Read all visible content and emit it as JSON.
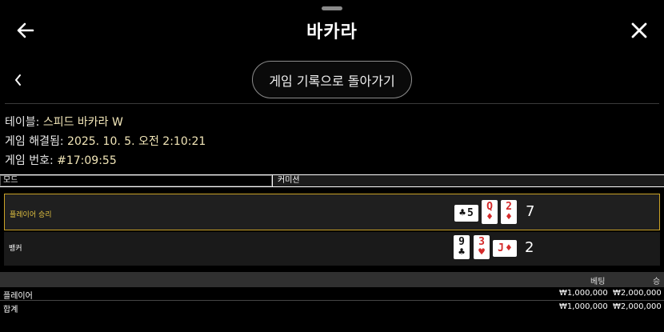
{
  "header": {
    "title": "바카라",
    "back_icon": "arrow-left-icon",
    "close_icon": "close-icon"
  },
  "nav": {
    "prev_icon": "chevron-left-icon",
    "back_to_history_label": "게임 기록으로 돌아가기"
  },
  "info": {
    "table_label": "테이블:",
    "table_value": "스피드 바카라 W",
    "resolved_label": "게임 해결됨:",
    "resolved_value": "2025. 10. 5. 오전 2:10:21",
    "game_no_label": "게임 번호:",
    "game_no_value": "#17:09:55"
  },
  "mode": {
    "label": "모드",
    "value": "커미션"
  },
  "results": {
    "player": {
      "label": "플레이어 승리",
      "score": "7",
      "cards": [
        {
          "rank": "5",
          "suit": "♣",
          "color": "black",
          "sideways": true
        },
        {
          "rank": "Q",
          "suit": "♦",
          "color": "red",
          "sideways": false
        },
        {
          "rank": "2",
          "suit": "♦",
          "color": "red",
          "sideways": false
        }
      ]
    },
    "banker": {
      "label": "뱅커",
      "score": "2",
      "cards": [
        {
          "rank": "9",
          "suit": "♣",
          "color": "black",
          "sideways": false
        },
        {
          "rank": "3",
          "suit": "♥",
          "color": "red",
          "sideways": false
        },
        {
          "rank": "J",
          "suit": "♦",
          "color": "red",
          "sideways": true
        }
      ]
    }
  },
  "bets": {
    "headers": {
      "bet": "베팅",
      "win": "승"
    },
    "rows": [
      {
        "name": "플레이어",
        "bet": "₩1,000,000",
        "win": "₩2,000,000"
      },
      {
        "name": "합계",
        "bet": "₩1,000,000",
        "win": "₩2,000,000"
      }
    ]
  },
  "colors": {
    "accent_gold": "#c9a227",
    "info_value": "#f2e6b8",
    "card_red": "#d42a2a"
  }
}
